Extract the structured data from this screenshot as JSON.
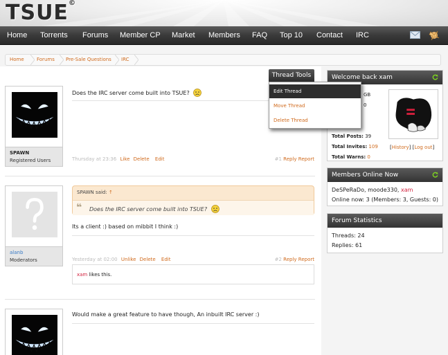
{
  "header": {
    "logo": "TSUE",
    "logo_mark": "©"
  },
  "nav": {
    "items": [
      "Home",
      "Torrents",
      "Forums",
      "Member CP",
      "Market",
      "Members",
      "FAQ",
      "Top 10",
      "Contact",
      "IRC"
    ],
    "icons": [
      "envelope-icon",
      "alerts-icon"
    ]
  },
  "breadcrumb": [
    "Home",
    "Forums",
    "Pre-Sale Questions",
    "IRC"
  ],
  "thread_tools": {
    "label": "Thread Tools",
    "items": [
      "Edit Thread",
      "Move Thread",
      "Delete Thread"
    ]
  },
  "posts": [
    {
      "username": "SPAWN",
      "usertitle": "Registered Users",
      "text": "Does the IRC server come built into TSUE?",
      "time": "Thursday at 23:36",
      "actions": [
        "Like",
        "Delete",
        "Edit"
      ],
      "number": "#1",
      "reply": "Reply",
      "report": "Report"
    },
    {
      "username": "alanb",
      "usertitle": "Moderators",
      "quote_author": "SPAWN said:",
      "quote_arrow": "↑",
      "quote_text": "Does the IRC server come built into TSUE?",
      "text": "Its a client  :)  based on mibbit  I think  :)",
      "time": "Yesterday at 02:00",
      "actions": [
        "Unlike",
        "Delete",
        "Edit"
      ],
      "number": "#2",
      "reply": "Reply",
      "report": "Report",
      "likes_user": "xam",
      "likes_suffix": "likes this."
    },
    {
      "text": "Would make a great feature to have though, An inbuilt IRC server :)"
    }
  ],
  "sidebar": {
    "welcome": {
      "title": "Welcome back xam",
      "partial_1": "GB",
      "partial_2": "0",
      "total_posts_label": "Total Posts:",
      "total_posts": "39",
      "total_invites_label": "Total Invites:",
      "total_invites": "109",
      "total_warns_label": "Total Warns:",
      "total_warns": "0",
      "history": "History",
      "logout": "Log out"
    },
    "online": {
      "title": "Members Online Now",
      "users": [
        "DeSPeRaDo",
        "moode330",
        "xam"
      ],
      "summary": "Online now: 3 (Members: 3, Guests: 0)"
    },
    "stats": {
      "title": "Forum Statistics",
      "threads": "Threads: 24",
      "replies": "Replies: 61"
    }
  },
  "colors": {
    "accent": "#d06a1c",
    "highlight": "#d21f3c",
    "nav": "#333333"
  }
}
